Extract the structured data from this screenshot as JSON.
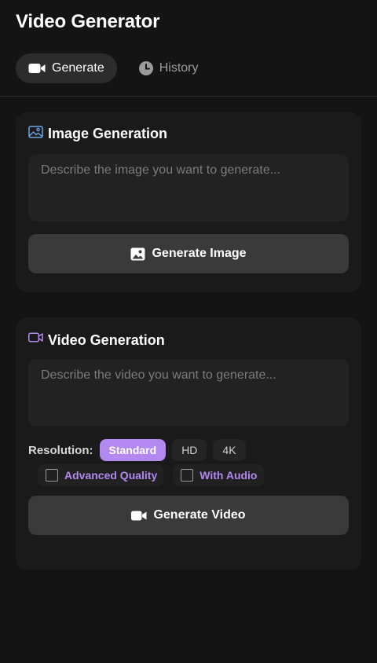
{
  "app": {
    "title": "Video Generator"
  },
  "tabs": [
    {
      "label": "Generate",
      "icon": "video-camera-icon",
      "active": true
    },
    {
      "label": "History",
      "icon": "clock-icon",
      "active": false
    }
  ],
  "image_section": {
    "title": "Image Generation",
    "icon": "image-icon",
    "placeholder": "Describe the image you want to generate...",
    "button_label": "Generate Image",
    "button_icon": "image-icon"
  },
  "video_section": {
    "title": "Video Generation",
    "icon": "video-camera-icon",
    "placeholder": "Describe the video you want to generate...",
    "resolution_label": "Resolution:",
    "resolution_options": [
      {
        "label": "Standard",
        "selected": true
      },
      {
        "label": "HD",
        "selected": false
      },
      {
        "label": "4K",
        "selected": false
      }
    ],
    "checkboxes": [
      {
        "label": "Advanced Quality",
        "checked": false
      },
      {
        "label": "With Audio",
        "checked": false
      }
    ],
    "button_label": "Generate Video",
    "button_icon": "video-camera-icon"
  },
  "colors": {
    "background": "#141414",
    "card": "#1a1a1a",
    "accent": "#b388f0",
    "image_icon": "#6aa8e8",
    "video_icon": "#b388f0"
  }
}
